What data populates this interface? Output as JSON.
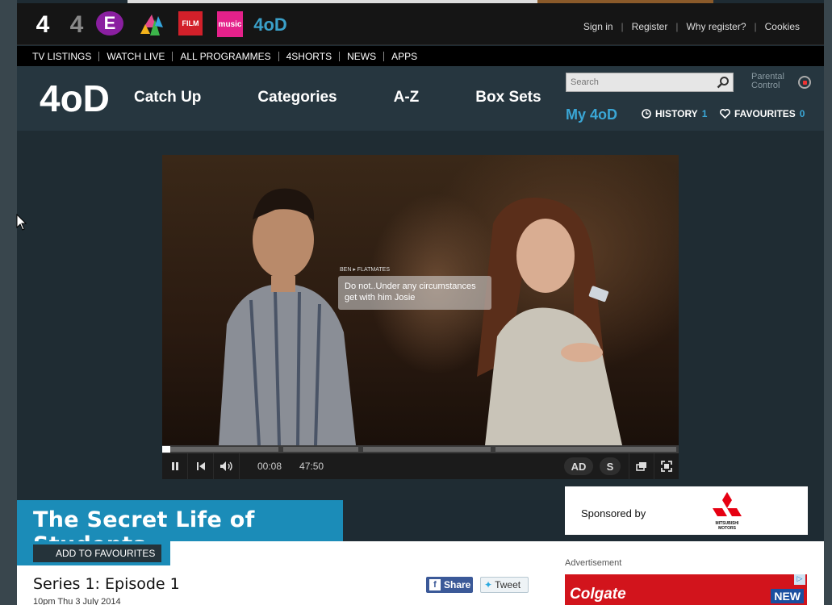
{
  "channels": {
    "items": [
      {
        "name": "Channel 4",
        "glyph": "4"
      },
      {
        "name": "More4",
        "glyph": "4"
      },
      {
        "name": "E4",
        "glyph": "E"
      },
      {
        "name": "4seven",
        "glyph": "4seven"
      },
      {
        "name": "Film4",
        "glyph": "FILM"
      },
      {
        "name": "4Music",
        "glyph": "music"
      },
      {
        "name": "4oD",
        "glyph": "4oD"
      }
    ]
  },
  "user_links": {
    "sign_in": "Sign in",
    "register": "Register",
    "why_register": "Why register?",
    "cookies": "Cookies"
  },
  "nav": {
    "items": [
      "TV LISTINGS",
      "WATCH LIVE",
      "ALL PROGRAMMES",
      "4SHORTS",
      "NEWS",
      "APPS"
    ]
  },
  "od_header": {
    "logo": "4oD",
    "menu": [
      "Catch Up",
      "Categories",
      "A-Z",
      "Box Sets"
    ],
    "search_placeholder": "Search",
    "parental_line1": "Parental",
    "parental_line2": "Control",
    "my4od": "My 4oD",
    "history_label": "HISTORY",
    "history_count": "1",
    "favourites_label": "FAVOURITES",
    "favourites_count": "0"
  },
  "player": {
    "caption_tag": "BEN ▸ FLATMATES",
    "caption_text": "Do not..Under any circumstances get with him Josie",
    "current_time": "00:08",
    "duration": "47:50",
    "progress_fraction": 0.003,
    "ad_break_fractions": [
      0.23,
      0.385,
      0.64
    ],
    "audio_description": "AD",
    "subtitles": "S",
    "colors": {
      "bar": "#3b3b3b",
      "played": "#ffffff",
      "control_bg": "#1b1b1b"
    }
  },
  "programme": {
    "title": "The Secret Life of Students",
    "add_to_favourites": "ADD TO FAVOURITES",
    "episode_title": "Series 1: Episode 1",
    "episode_meta": "10pm Thu 3 July 2014",
    "share_label": "Share",
    "tweet_label": "Tweet"
  },
  "sponsor": {
    "label": "Sponsored by",
    "brand": "MITSUBISHI MOTORS"
  },
  "advert": {
    "label": "Advertisement",
    "brand": "Colgate",
    "badge": "NEW"
  },
  "colors": {
    "accent": "#1b8cb8",
    "link_blue": "#3aa7d6",
    "header_bg": "#26363f",
    "page_bg": "#1e2b33"
  }
}
